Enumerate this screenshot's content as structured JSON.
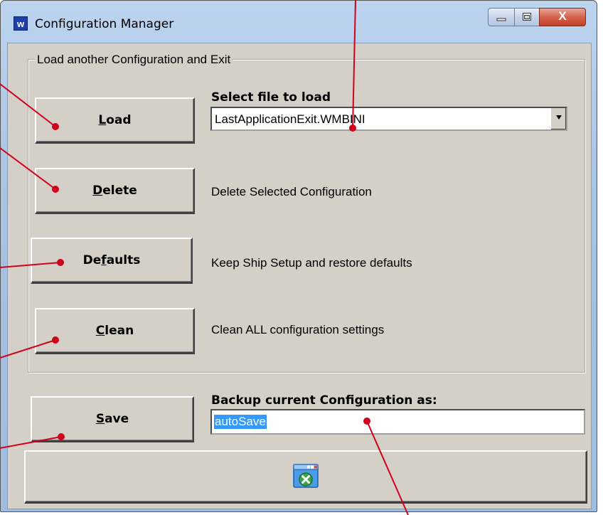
{
  "window": {
    "title": "Configuration Manager",
    "app_icon_glyph": "w",
    "close_glyph": "X"
  },
  "group": {
    "label": "Load another Configuration and Exit"
  },
  "buttons": {
    "load": {
      "pre": "",
      "accel": "L",
      "post": "oad"
    },
    "delete": {
      "pre": "",
      "accel": "D",
      "post": "elete"
    },
    "defaults": {
      "pre": "De",
      "accel": "f",
      "post": "aults"
    },
    "clean": {
      "pre": "",
      "accel": "C",
      "post": "lean"
    },
    "save": {
      "pre": "",
      "accel": "S",
      "post": "ave"
    }
  },
  "file_select": {
    "label": "Select file to load",
    "value": "LastApplicationExit.WMBINI"
  },
  "descriptions": {
    "delete": "Delete Selected Configuration",
    "defaults": "Keep Ship Setup and restore defaults",
    "clean": "Clean ALL configuration settings"
  },
  "backup": {
    "label": "Backup current Configuration as:",
    "value": "autoSave"
  },
  "icons": {
    "app": "app-logo-icon",
    "exit": "exit-window-icon",
    "minimize": "minimize-icon",
    "maximize": "maximize-icon",
    "close": "close-icon"
  },
  "colors": {
    "annotation": "#d0021b",
    "selection": "#3399ff",
    "face": "#d4d0c8"
  }
}
